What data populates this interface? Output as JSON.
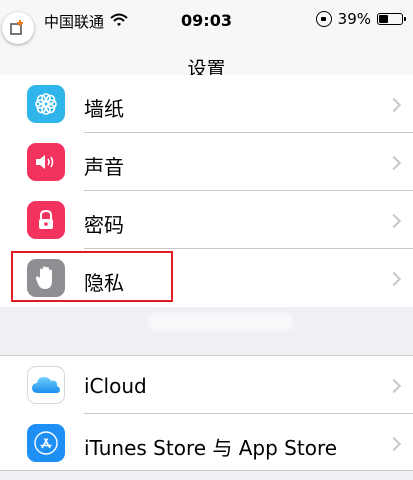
{
  "status_bar": {
    "carrier": "中国联通",
    "time": "09:03",
    "battery_percent": "39%",
    "battery_level": 0.39
  },
  "nav": {
    "title": "设置"
  },
  "settings_group_1": [
    {
      "label": "墙纸",
      "icon": "wallpaper-icon",
      "color": "#2fb5ea"
    },
    {
      "label": "声音",
      "icon": "speaker-icon",
      "color": "#f3335e"
    },
    {
      "label": "密码",
      "icon": "lock-icon",
      "color": "#f3335e"
    },
    {
      "label": "隐私",
      "icon": "hand-icon",
      "color": "#8e8e93",
      "highlighted": true
    }
  ],
  "settings_group_2": [
    {
      "label": "iCloud",
      "icon": "cloud-icon",
      "color": "#ffffff"
    },
    {
      "label": "iTunes Store 与 App Store",
      "icon": "app-store-icon",
      "color": "#1d8ff5"
    }
  ]
}
